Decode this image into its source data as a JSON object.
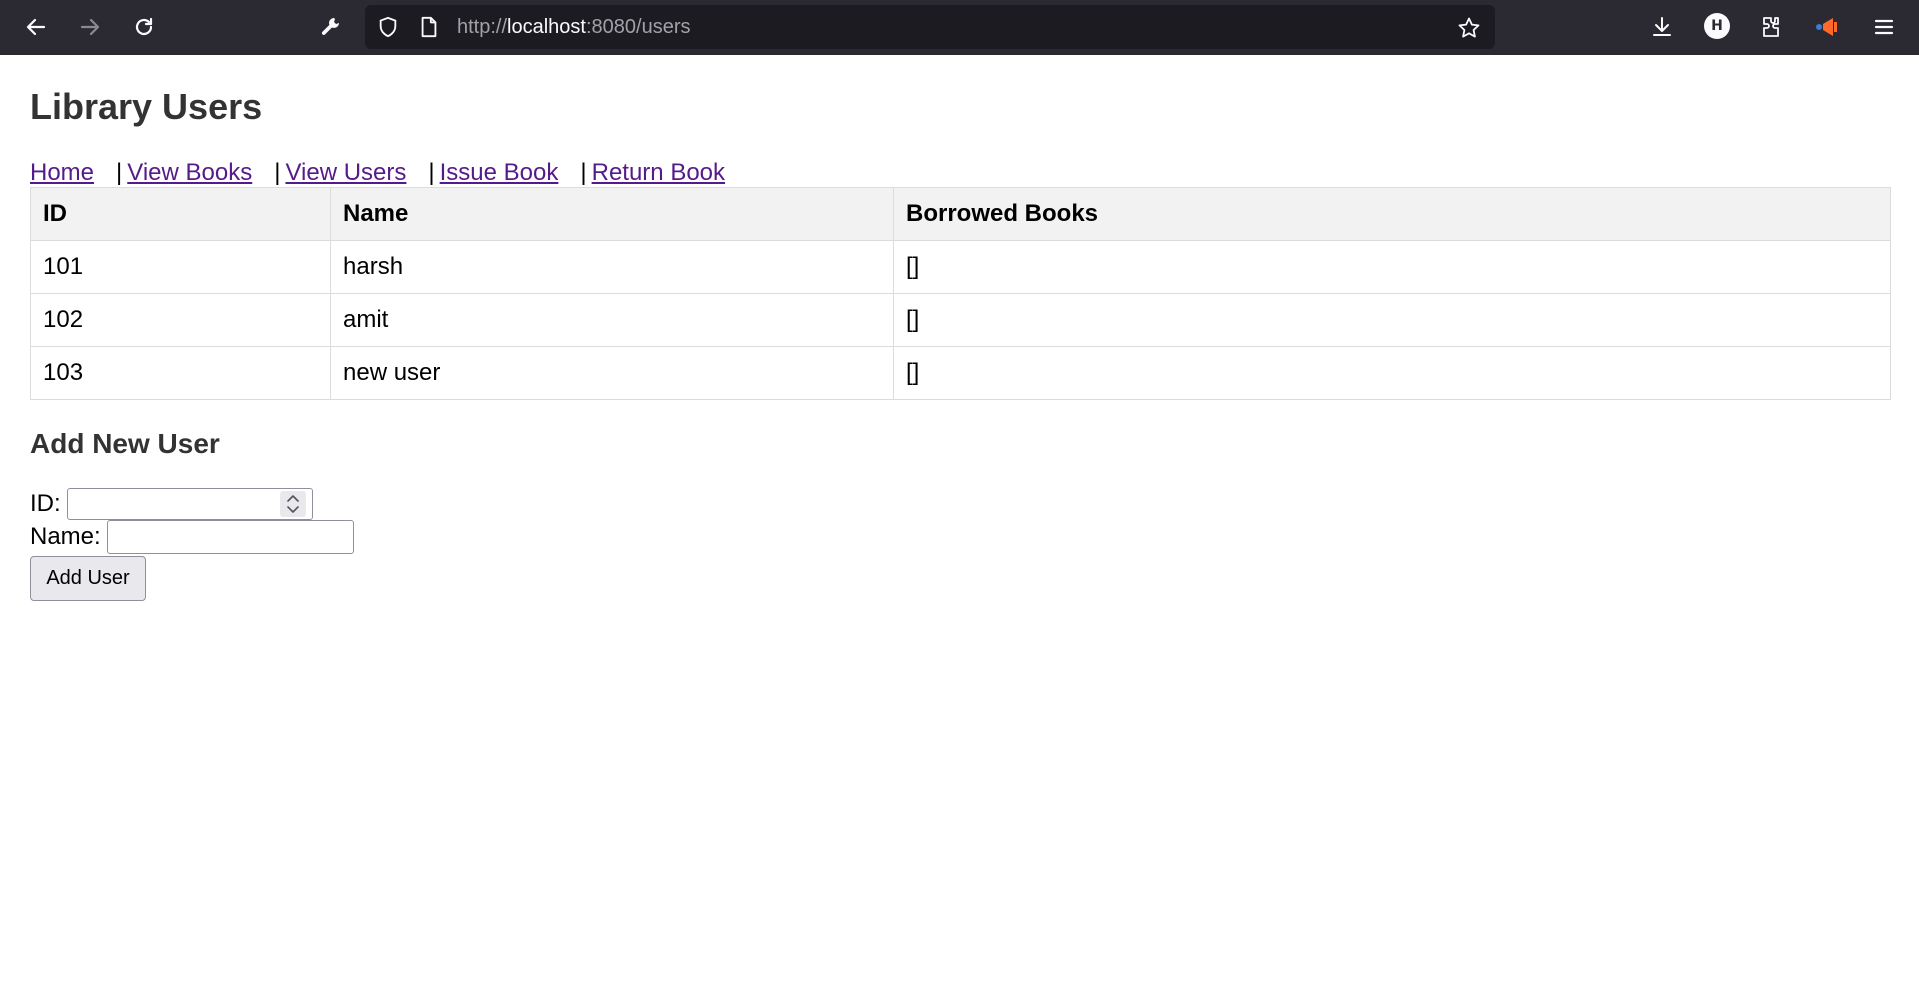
{
  "browser": {
    "url_prefix": "http://",
    "url_host": "localhost",
    "url_rest": ":8080/users",
    "profile_initial": "H"
  },
  "page": {
    "title": "Library Users",
    "nav": [
      {
        "label": "Home"
      },
      {
        "label": "View Books"
      },
      {
        "label": "View Users"
      },
      {
        "label": "Issue Book"
      },
      {
        "label": "Return Book"
      }
    ],
    "nav_separator": "|"
  },
  "table": {
    "headers": [
      "ID",
      "Name",
      "Borrowed Books"
    ],
    "rows": [
      [
        "101",
        "harsh",
        "[]"
      ],
      [
        "102",
        "amit",
        "[]"
      ],
      [
        "103",
        "new user",
        "[]"
      ]
    ]
  },
  "form": {
    "heading": "Add New User",
    "id_label": "ID:",
    "id_value": "",
    "name_label": "Name:",
    "name_value": "",
    "submit_label": "Add User"
  },
  "icons": {
    "back": "back-arrow-icon",
    "forward": "forward-arrow-icon",
    "reload": "reload-icon",
    "tools": "wrench-icon",
    "tracking": "shield-icon",
    "page": "page-icon",
    "bookmark": "star-icon",
    "downloads": "download-icon",
    "extensions": "puzzle-icon",
    "extension": "megaphone-icon",
    "menu": "hamburger-menu-icon"
  },
  "colors": {
    "toolbar_bg": "#2b2a33",
    "urlbar_bg": "#1c1b22",
    "link": "#551a8b",
    "heading": "#333333",
    "table_header_bg": "#f2f2f2"
  }
}
